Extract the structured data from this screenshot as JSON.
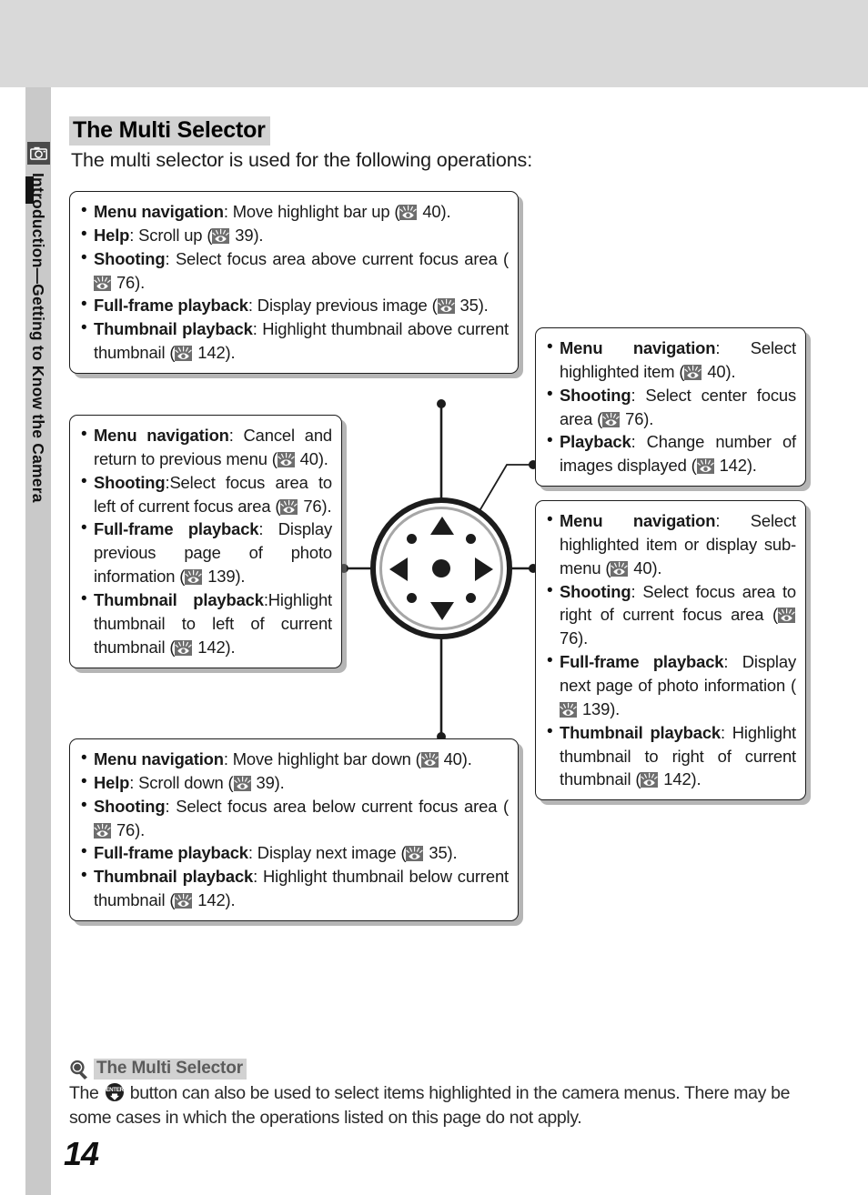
{
  "page": {
    "number": "14",
    "title": "The Multi Selector",
    "intro": "The multi selector is used for the following operations:",
    "sidebar_label": "Introduction—Getting to Know the Camera",
    "sidebar_icon": "camera-icon",
    "reference_icon": "eye-reference-icon"
  },
  "callouts": {
    "up": {
      "name": "multi-selector-up-callout",
      "items": [
        {
          "term": "Menu navigation",
          "sep": ": ",
          "text": "Move highlight bar up (",
          "ref": "40",
          "tail": ")."
        },
        {
          "term": "Help",
          "sep": ": ",
          "text": "Scroll up (",
          "ref": "39",
          "tail": ")."
        },
        {
          "term": "Shooting",
          "sep": ": ",
          "text": "Select focus area above current focus area (",
          "ref": "76",
          "tail": ")."
        },
        {
          "term": "Full-frame playback",
          "sep": ": ",
          "text": "Display previous image (",
          "ref": "35",
          "tail": ")."
        },
        {
          "term": "Thumbnail playback",
          "sep": ": ",
          "text": "Highlight thumbnail above current thumbnail (",
          "ref": "142",
          "tail": ")."
        }
      ]
    },
    "left": {
      "name": "multi-selector-left-callout",
      "items": [
        {
          "term": "Menu navigation",
          "sep": ": ",
          "text": "Cancel and return to previous menu (",
          "ref": "40",
          "tail": ")."
        },
        {
          "term": "Shooting",
          "sep": ":",
          "text": "Select focus area to left of current focus area (",
          "ref": "76",
          "tail": ")."
        },
        {
          "term": "Full-frame playback",
          "sep": ": ",
          "text": "Display previous page of photo information (",
          "ref": "139",
          "tail": ")."
        },
        {
          "term": "Thumbnail playback",
          "sep": ":",
          "text": "Highlight thumbnail to left of current thumbnail (",
          "ref": "142",
          "tail": ")."
        }
      ]
    },
    "down": {
      "name": "multi-selector-down-callout",
      "items": [
        {
          "term": "Menu navigation",
          "sep": ": ",
          "text": "Move highlight bar down (",
          "ref": "40",
          "tail": ")."
        },
        {
          "term": "Help",
          "sep": ": ",
          "text": "Scroll down (",
          "ref": "39",
          "tail": ")."
        },
        {
          "term": "Shooting",
          "sep": ": ",
          "text": "Select focus area below current focus area (",
          "ref": "76",
          "tail": ")."
        },
        {
          "term": "Full-frame playback",
          "sep": ": ",
          "text": "Display next image (",
          "ref": "35",
          "tail": ")."
        },
        {
          "term": "Thumbnail playback",
          "sep": ": ",
          "text": "Highlight thumbnail below current thumbnail (",
          "ref": "142",
          "tail": ")."
        }
      ]
    },
    "center": {
      "name": "multi-selector-center-callout",
      "items": [
        {
          "term": "Menu navigation",
          "sep": ": ",
          "text": "Select highlighted item (",
          "ref": "40",
          "tail": ")."
        },
        {
          "term": "Shooting",
          "sep": ": ",
          "text": "Select center focus area (",
          "ref": "76",
          "tail": ")."
        },
        {
          "term": "Playback",
          "sep": ": ",
          "text": "Change number of images displayed (",
          "ref": "142",
          "tail": ")."
        }
      ]
    },
    "right": {
      "name": "multi-selector-right-callout",
      "items": [
        {
          "term": "Menu navigation",
          "sep": ": ",
          "text": "Select highlighted item or display sub-menu (",
          "ref": "40",
          "tail": ")."
        },
        {
          "term": "Shooting",
          "sep": ": ",
          "text": "Select focus area to right of current focus area (",
          "ref": "76",
          "tail": ")."
        },
        {
          "term": "Full-frame playback",
          "sep": ": ",
          "text": "Display next page of photo information (",
          "ref": "139",
          "tail": ")."
        },
        {
          "term": "Thumbnail playback",
          "sep": ": ",
          "text": "Highlight thumbnail to right of current thumbnail (",
          "ref": "142",
          "tail": ")."
        }
      ]
    }
  },
  "dial": {
    "name": "multi-selector-dial",
    "up_arrow": "triangle-up-icon",
    "down_arrow": "triangle-down-icon",
    "left_arrow": "triangle-left-icon",
    "right_arrow": "triangle-right-icon",
    "center": "center-button"
  },
  "note": {
    "icon": "magnifier-icon",
    "title": "The Multi Selector",
    "text_before_button": "The ",
    "button_icon": "enter-button-icon",
    "text_after_button": " button can also be used to select items highlighted in the camera menus.  There may be some cases in which the operations listed on this page do not apply."
  },
  "colors": {
    "top_band": "#d9d9d9",
    "sidebar": "#c9c9c9",
    "title_highlight": "#d2d2d2",
    "ink": "#1a1a1a",
    "ref_icon_bg": "#6e6e6e",
    "note_title": "#5b5b5b"
  }
}
